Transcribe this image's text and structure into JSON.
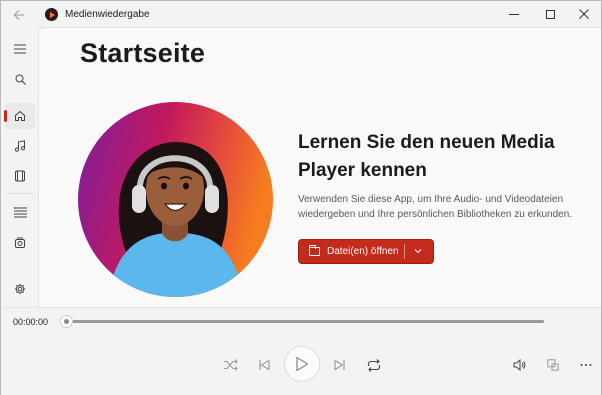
{
  "app": {
    "title": "Medienwiedergabe",
    "accent": "#c42b1c"
  },
  "window_controls": {
    "minimize_icon": "minimize-icon",
    "maximize_icon": "maximize-icon",
    "close_icon": "close-icon"
  },
  "sidebar": {
    "items": [
      {
        "name": "menu",
        "icon": "hamburger-icon"
      },
      {
        "name": "search",
        "icon": "search-icon"
      },
      {
        "name": "home",
        "icon": "home-icon",
        "active": true
      },
      {
        "name": "music",
        "icon": "music-note-icon"
      },
      {
        "name": "video",
        "icon": "film-icon"
      },
      {
        "name": "playlists",
        "icon": "playlist-icon"
      },
      {
        "name": "play-queue",
        "icon": "play-queue-icon"
      },
      {
        "name": "settings",
        "icon": "gear-icon"
      }
    ]
  },
  "main": {
    "page_title": "Startseite",
    "hero": {
      "heading": "Lernen Sie den neuen Media Player kennen",
      "description": "Verwenden Sie diese App, um Ihre Audio- und Videodateien wiedergeben und Ihre persönlichen Bibliotheken zu erkunden.",
      "open_button_label": "Datei(en) öffnen"
    }
  },
  "player": {
    "current_time": "00:00:00",
    "progress": 0,
    "controls": [
      "shuffle-icon",
      "previous-icon",
      "play-icon",
      "next-icon",
      "repeat-icon",
      "volume-icon",
      "mini-player-icon",
      "more-icon"
    ]
  }
}
